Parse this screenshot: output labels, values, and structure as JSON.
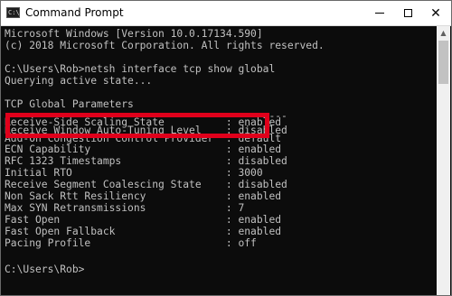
{
  "window": {
    "title": "Command Prompt",
    "icon": "console-icon",
    "icon_text": "C:\\"
  },
  "console": {
    "lines": [
      "Microsoft Windows [Version 10.0.17134.590]",
      "(c) 2018 Microsoft Corporation. All rights reserved.",
      "",
      "C:\\Users\\Rob>netsh interface tcp show global",
      "Querying active state...",
      "",
      "TCP Global Parameters",
      "----------------------------------------------",
      "Receive-Side Scaling State          : enabled",
      "Receive Window Auto-Tuning Level    : disabled",
      "Add-On Congestion Control Provider  : default",
      "ECN Capability                      : enabled",
      "RFC 1323 Timestamps                 : disabled",
      "Initial RTO                         : 3000",
      "Receive Segment Coalescing State    : disabled",
      "Non Sack Rtt Resiliency             : enabled",
      "Max SYN Retransmissions             : 7",
      "Fast Open                           : enabled",
      "Fast Open Fallback                  : enabled",
      "Pacing Profile                      : off",
      "",
      "",
      "C:\\Users\\Rob>"
    ]
  },
  "colors": {
    "console_bg": "#0c0c0c",
    "console_text": "#c0c0c0",
    "highlight": "#e0001b"
  }
}
